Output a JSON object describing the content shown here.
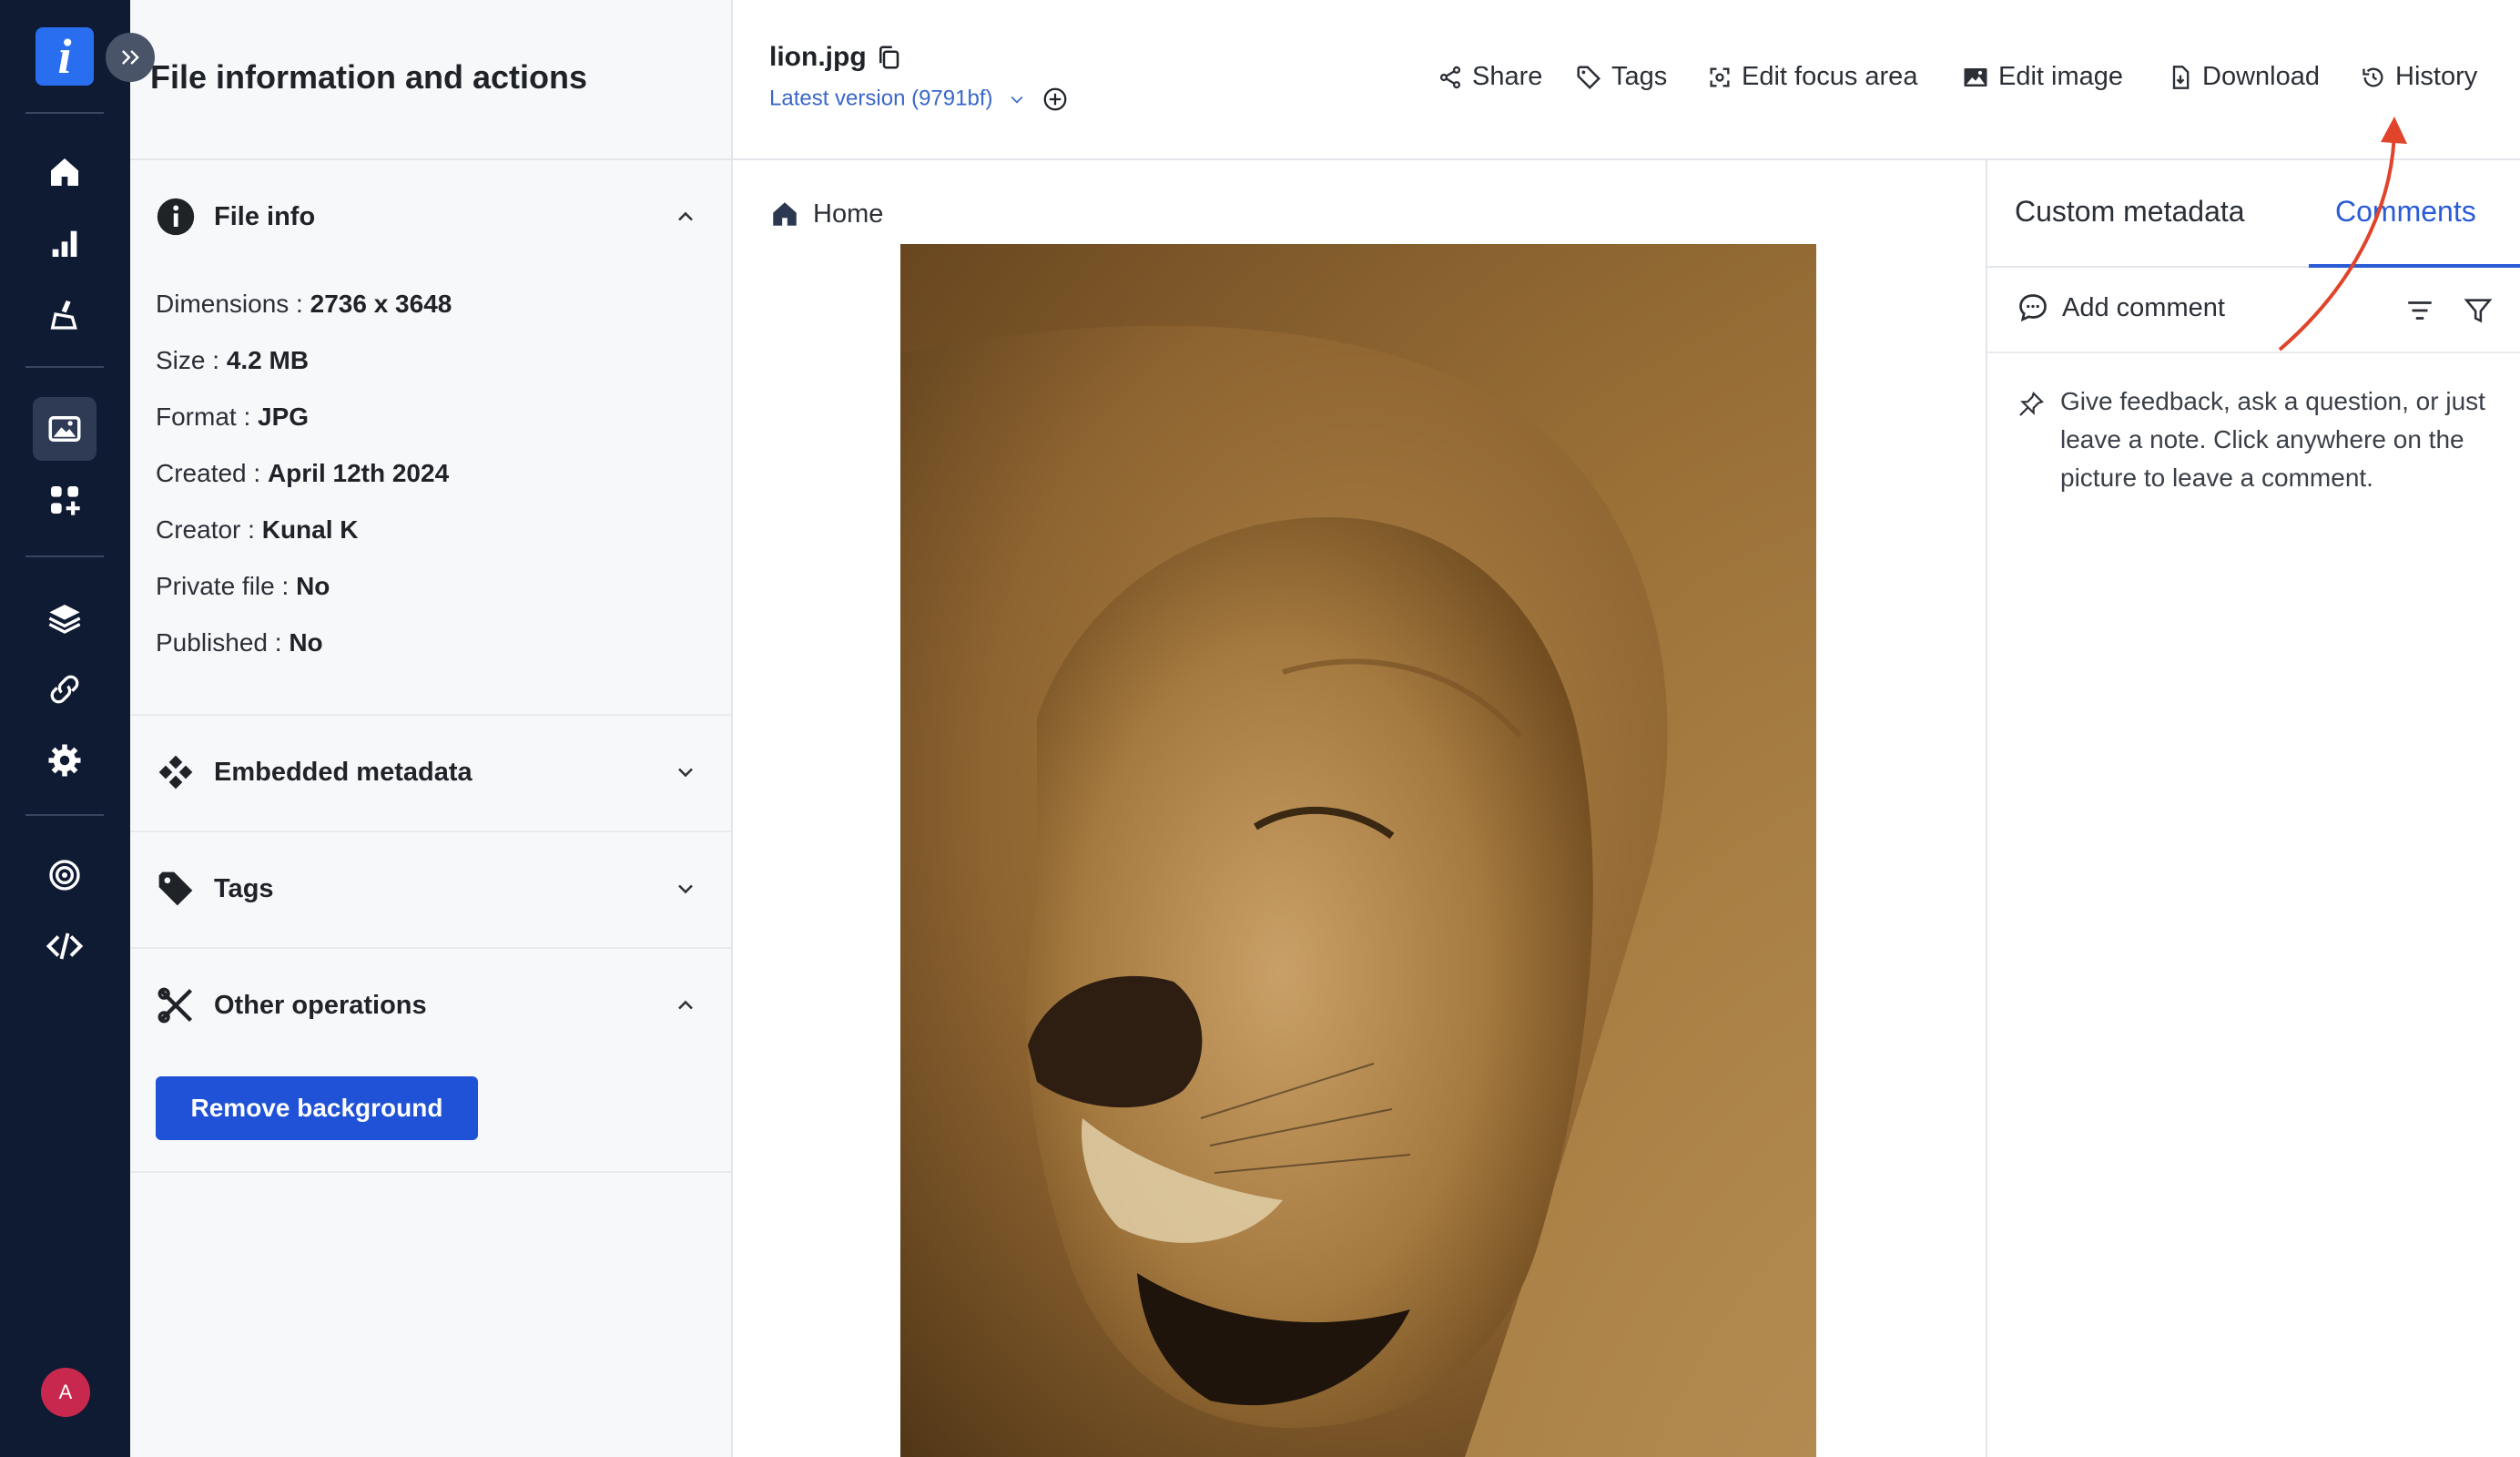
{
  "nav": {
    "logo": "i",
    "avatar_initial": "A"
  },
  "panel": {
    "title": "File information and actions",
    "file_info": {
      "heading": "File info",
      "rows": [
        {
          "label": "Dimensions :",
          "value": "2736 x 3648"
        },
        {
          "label": "Size :",
          "value": "4.2 MB"
        },
        {
          "label": "Format :",
          "value": "JPG"
        },
        {
          "label": "Created :",
          "value": "April 12th 2024"
        },
        {
          "label": "Creator :",
          "value": "Kunal K"
        },
        {
          "label": "Private file :",
          "value": "No"
        },
        {
          "label": "Published :",
          "value": "No"
        }
      ]
    },
    "embedded_metadata": "Embedded metadata",
    "tags": "Tags",
    "other_operations": "Other operations",
    "remove_background": "Remove background"
  },
  "header": {
    "filename": "lion.jpg",
    "version": "Latest version (9791bf)",
    "actions": {
      "share": "Share",
      "tags": "Tags",
      "edit_focus": "Edit focus area",
      "edit_image": "Edit image",
      "download": "Download",
      "history": "History"
    }
  },
  "breadcrumb": {
    "home": "Home"
  },
  "right_panel": {
    "tab_custom": "Custom metadata",
    "tab_comments": "Comments",
    "add_comment": "Add comment",
    "hint": "Give feedback, ask a question, or just leave a note. Click anywhere on the picture to leave a comment."
  },
  "colors": {
    "nav_bg": "#0f1a33",
    "accent": "#1f52d6",
    "link": "#3a67c9",
    "annotation_arrow": "#e0442b"
  }
}
